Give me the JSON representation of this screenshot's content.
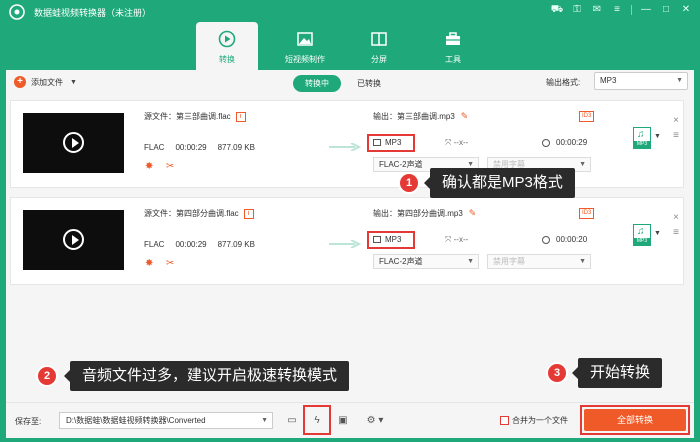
{
  "app": {
    "title": "数据蛙视频转换器（未注册）"
  },
  "nav": {
    "tabs": [
      {
        "label": "转换",
        "icon": "convert-icon"
      },
      {
        "label": "短视频制作",
        "icon": "image-icon"
      },
      {
        "label": "分屏",
        "icon": "split-screen-icon"
      },
      {
        "label": "工具",
        "icon": "toolbox-icon"
      }
    ]
  },
  "toolbar": {
    "add_file": "添加文件",
    "converting": "转换中",
    "converted": "已转换",
    "output_format_label": "输出格式:",
    "output_format_value": "MP3"
  },
  "files": [
    {
      "source": "源文件：第三部曲调.flac",
      "format": "FLAC",
      "duration": "00:00:29",
      "size": "877.09 KB",
      "output": "输出：第三部曲调.mp3",
      "out_format": "MP3",
      "resolution": "--x--",
      "out_duration": "00:00:29",
      "audio_track": "FLAC-2声道",
      "subtitle": "禁用字幕"
    },
    {
      "source": "源文件：第四部分曲调.flac",
      "format": "FLAC",
      "duration": "00:00:29",
      "size": "877.09 KB",
      "output": "输出：第四部分曲调.mp3",
      "out_format": "MP3",
      "resolution": "--x--",
      "out_duration": "00:00:20",
      "audio_track": "FLAC-2声道",
      "subtitle": "禁用字幕"
    }
  ],
  "callouts": [
    {
      "num": "1",
      "text": "确认都是MP3格式"
    },
    {
      "num": "2",
      "text": "音频文件过多，建议开启极速转换模式"
    },
    {
      "num": "3",
      "text": "开始转换"
    }
  ],
  "bottom": {
    "save_label": "保存至:",
    "path": "D:\\数据蛙\\数据蛙视频转换器\\Converted",
    "merge_label": "合并为一个文件",
    "convert_all": "全部转换"
  },
  "colors": {
    "brand": "#1fa97a",
    "accent": "#f05a28",
    "highlight": "#e53935"
  }
}
